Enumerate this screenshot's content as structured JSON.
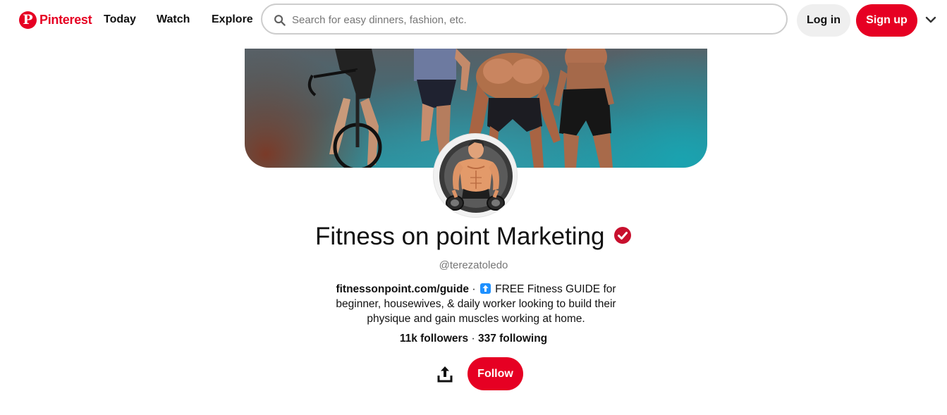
{
  "header": {
    "logo_text": "Pinterest",
    "nav": [
      {
        "label": "Today"
      },
      {
        "label": "Watch"
      },
      {
        "label": "Explore"
      }
    ],
    "search_placeholder": "Search for easy dinners, fashion, etc.",
    "login_label": "Log in",
    "signup_label": "Sign up",
    "accent_color": "#e60023"
  },
  "profile": {
    "name": "Fitness on point Marketing",
    "handle": "@terezatoledo",
    "bio_link": "fitnessonpoint.com/guide",
    "bio_separator": " · ",
    "bio_text": " FREE Fitness GUIDE for beginner, housewives, & daily worker looking to build their physique and gain muscles working at home.",
    "followers": "11k followers",
    "stats_separator": " · ",
    "following": "337 following",
    "follow_label": "Follow",
    "verified": true
  },
  "icons": {
    "logo": "pinterest-logo-icon",
    "search": "search-icon",
    "chevron": "chevron-down-icon",
    "verified": "verified-check-icon",
    "share": "share-icon"
  }
}
